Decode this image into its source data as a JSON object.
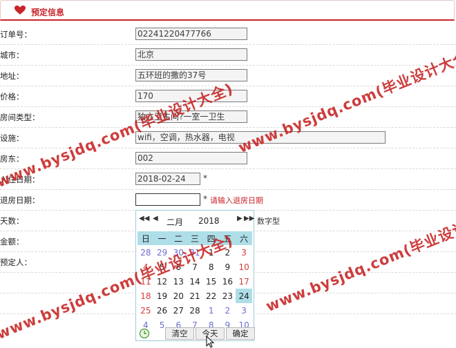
{
  "header": {
    "title": "预定信息",
    "icon": "heart-icon"
  },
  "form": {
    "order_no": {
      "label": "订单号：",
      "value": "02241220477766"
    },
    "city": {
      "label": "城市：",
      "value": "北京"
    },
    "address": {
      "label": "地址：",
      "value": "五环班的撒的37号"
    },
    "price": {
      "label": "价格：",
      "value": "170"
    },
    "room_type": {
      "label": "房间类型：",
      "value": "独立卫生间?一室一卫生"
    },
    "facilities": {
      "label": "设施：",
      "value": "wifi，空调，热水器，电视"
    },
    "landlord": {
      "label": "房东：",
      "value": "002"
    },
    "checkin": {
      "label": "入住日期：",
      "value": "2018-02-24",
      "required": "*"
    },
    "checkout": {
      "label": "退房日期：",
      "value": "",
      "required": "*",
      "error": "请输入退房日期"
    },
    "days": {
      "label": "天数：",
      "hint": "数字型"
    },
    "amount": {
      "label": "金额："
    },
    "booker": {
      "label": "预定人："
    }
  },
  "calendar": {
    "month": "二月",
    "year": "2018",
    "weekdays": [
      "日",
      "一",
      "二",
      "三",
      "四",
      "五",
      "六"
    ],
    "weeks": [
      [
        "28",
        "29",
        "30",
        "31",
        "1",
        "2",
        "3"
      ],
      [
        "4",
        "5",
        "6",
        "7",
        "8",
        "9",
        "10"
      ],
      [
        "11",
        "12",
        "13",
        "14",
        "15",
        "16",
        "17"
      ],
      [
        "18",
        "19",
        "20",
        "21",
        "22",
        "23",
        "24"
      ],
      [
        "25",
        "26",
        "27",
        "28",
        "1",
        "2",
        "3"
      ],
      [
        "4",
        "5",
        "6",
        "7",
        "8",
        "9",
        "10"
      ]
    ],
    "selected": "24",
    "buttons": {
      "clear": "清空",
      "today": "今天",
      "ok": "确定"
    }
  },
  "watermark": "www.bysjdq.com(毕业设计大全)",
  "colors": {
    "accent": "#c9242b",
    "calendar_header": "#aedee8",
    "other_month": "#6b6bd1",
    "weekend": "#d43b3b"
  }
}
